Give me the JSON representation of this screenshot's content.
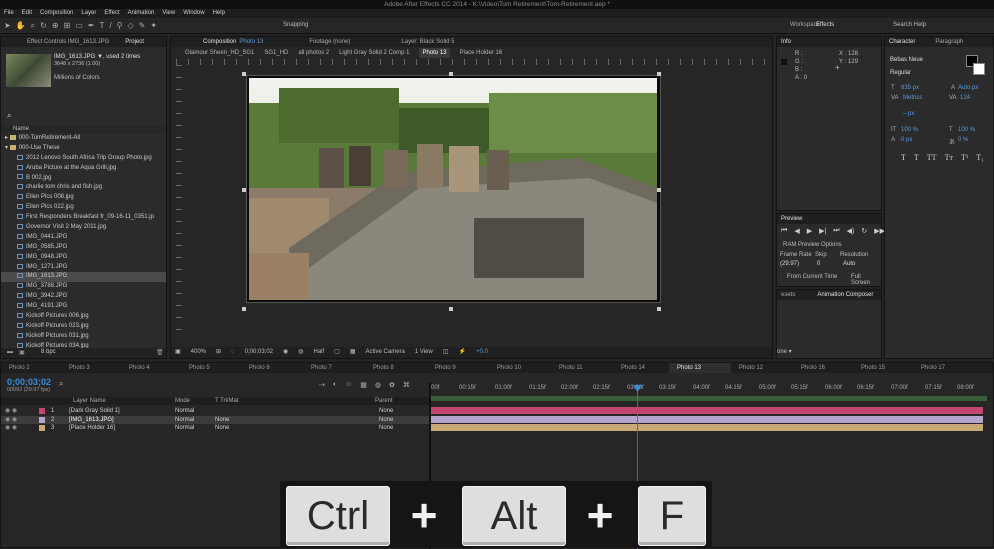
{
  "title": "Adobe After Effects CC 2014 - K:\\Video\\Tom Retirement\\Tom-Retirement.aep *",
  "menu": [
    "File",
    "Edit",
    "Composition",
    "Layer",
    "Effect",
    "Animation",
    "View",
    "Window",
    "Help"
  ],
  "toolbar": {
    "snapping": "Snapping",
    "workspace_label": "Workspace:",
    "workspace_value": "Effects",
    "search_help": "Search Help"
  },
  "project": {
    "tabs": {
      "effect_controls": "Effect Controls IMG_1613.JPG",
      "project": "Project"
    },
    "item_name": "IMG_1613.JPG ▼, used 2 times",
    "item_dims": "3648 x 2736 (1.00)",
    "item_colors": "Millions of Colors",
    "search_icon": "magnifier",
    "col_name": "Name",
    "folders": [
      "000-TomRetirement-All",
      "000-Use These"
    ],
    "files": [
      "2012 Lenovo South Africa Trip Group Photo.jpg",
      "Aruba Picture at the Aqua Grill.jpg",
      "B 002.jpg",
      "charlie tom chris and fish.jpg",
      "Ellen Pics 008.jpg",
      "Ellen Pics 022.jpg",
      "First Responders Breakfast fr_09-16-11_0351.jp",
      "Governor Visit 2 May 2011.jpg",
      "IMG_0441.JPG",
      "IMG_0585.JPG",
      "IMG_0948.JPG",
      "IMG_1271.JPG",
      "IMG_1613.JPG",
      "IMG_3788.JPG",
      "IMG_3942.JPG",
      "IMG_4191.JPG",
      "Kickoff Pictures 006.jpg",
      "Kickoff Pictures 023.jpg",
      "Kickoff Pictures 031.jpg",
      "Kickoff Pictures 034.jpg"
    ],
    "bpc": "8 bpc"
  },
  "comp": {
    "tabs": {
      "composition": "Composition",
      "comp_name": "Photo 13",
      "footage": "Footage (none)",
      "layer": "Layer: Black Solid 5"
    },
    "flow": [
      "Glamour Sheen_HD_SG1",
      "SG1_HD",
      "all photos 2",
      "Light Gray Solid 2 Comp 1",
      "Photo 13",
      "Place Holder 16"
    ],
    "zoom": "400%",
    "timecode": "0;00;03;02",
    "quality": "Half",
    "camera": "Active Camera",
    "views": "1 View",
    "exposure": "+0.0"
  },
  "info": {
    "title": "Info",
    "r": "R :",
    "g": "G :",
    "b": "B :",
    "a": "A : 0",
    "x": "X : 128",
    "y": "Y : 129"
  },
  "preview": {
    "title": "Preview",
    "ram": "RAM Preview Options",
    "frame_rate_label": "Frame Rate",
    "skip_label": "Skip",
    "resolution_label": "Resolution",
    "frame_rate": "(29.97)",
    "skip": "0",
    "resolution": "Auto",
    "from_current": "From Current Time",
    "full_screen": "Full Screen"
  },
  "animcomp": {
    "tab1": "esets",
    "tab2": "Animation Composer",
    "footer": "one ▾"
  },
  "character": {
    "tabs": {
      "character": "Character",
      "paragraph": "Paragraph"
    },
    "font": "Bebas Neue",
    "style": "Regular",
    "size": "835 px",
    "leading": "Auto px",
    "kerning": "Metrics",
    "tracking": "124",
    "stroke_unit": "– px",
    "vscale": "100 %",
    "hscale": "100 %",
    "baseline": "0 px",
    "tsume": "0 %",
    "styles": [
      "T",
      "T",
      "TT",
      "Tт",
      "T¹",
      "T₁"
    ]
  },
  "timeline": {
    "tabs": [
      "Photo 2",
      "Photo 3",
      "Photo 4",
      "Photo 5",
      "Photo 6",
      "Photo 7",
      "Photo 8",
      "Photo 9",
      "Photo 10",
      "Photo 11",
      "Photo 14",
      "Photo 13",
      "Photo 12",
      "Photo 16",
      "Photo 15",
      "Photo 17"
    ],
    "active": "Photo 13",
    "timecode": "0;00;03;02",
    "fps": "00092 (29.97 fps)",
    "cols": {
      "layer_name": "Layer Name",
      "mode": "Mode",
      "trkmat": "T TrkMat",
      "parent": "Parent"
    },
    "ruler": [
      "00f",
      "00:15f",
      "01:00f",
      "01:15f",
      "02:00f",
      "02:15f",
      "03:00f",
      "03:15f",
      "04:00f",
      "04:15f",
      "05:00f",
      "05:15f",
      "06:00f",
      "06:15f",
      "07:00f",
      "07:15f",
      "08:00f"
    ],
    "layers": [
      {
        "num": "1",
        "name": "[Dark Gray Solid 1]",
        "mode": "Normal",
        "trk": "",
        "parent": "None",
        "color": "#c2466e"
      },
      {
        "num": "2",
        "name": "[IMG_1613.JPG]",
        "mode": "Normal",
        "trk": "None",
        "parent": "None",
        "color": "#b5a4cc"
      },
      {
        "num": "3",
        "name": "[Place Holder 16]",
        "mode": "Normal",
        "trk": "None",
        "parent": "None",
        "color": "#c9a977"
      }
    ]
  },
  "keys": {
    "ctrl": "Ctrl",
    "plus": "+",
    "alt": "Alt",
    "f": "F"
  },
  "colors": {
    "bg": "#232323",
    "accent_blue": "#3a8cd9",
    "playhead": "#d33a3a",
    "layer_pink": "#c2466e",
    "layer_lavender": "#b5a4cc",
    "layer_tan": "#c9a977"
  }
}
